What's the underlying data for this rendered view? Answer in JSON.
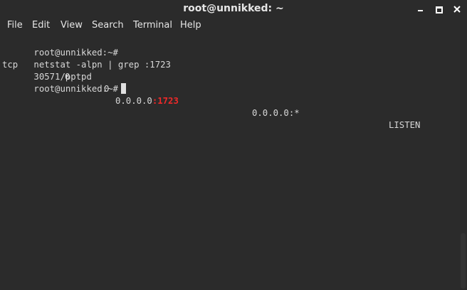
{
  "window": {
    "title": "root@unnikked: ~"
  },
  "menu": {
    "file": "File",
    "edit": "Edit",
    "view": "View",
    "search": "Search",
    "terminal": "Terminal",
    "help": "Help"
  },
  "terminal": {
    "line1": {
      "prompt": "root@unnikked:~#",
      "command": "netstat -alpn | grep :1723"
    },
    "line2": {
      "proto": "tcp",
      "recvq": "0",
      "sendq": "0",
      "local_host": "0.0.0.0",
      "local_port": ":1723",
      "foreign": "0.0.0.0:*",
      "state": "LISTEN"
    },
    "line3": {
      "pid_program": "30571/pptpd"
    },
    "line4": {
      "prompt": "root@unnikked:~#"
    }
  },
  "colors": {
    "background": "#2b2b2b",
    "text": "#d8d8d8",
    "highlight": "#ef2929"
  }
}
